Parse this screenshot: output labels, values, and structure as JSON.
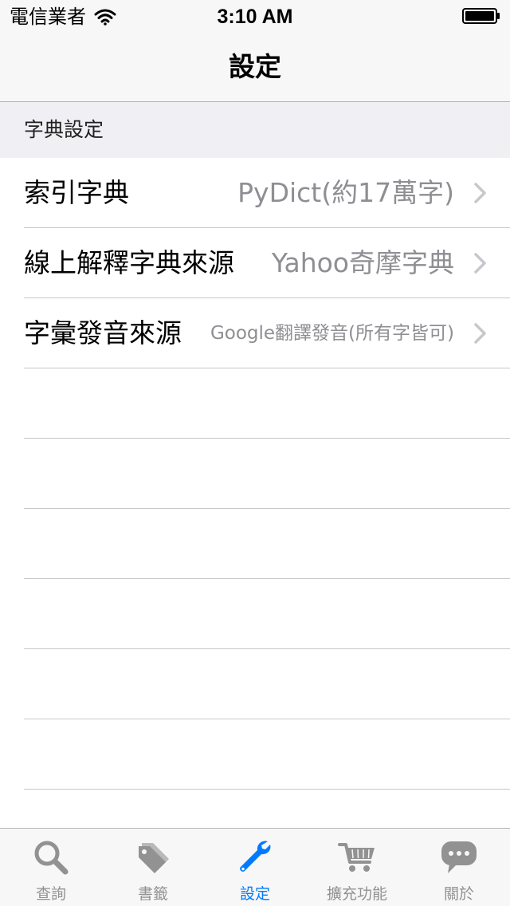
{
  "status_bar": {
    "carrier": "電信業者",
    "time": "3:10 AM"
  },
  "nav": {
    "title": "設定"
  },
  "section": {
    "header": "字典設定"
  },
  "rows": [
    {
      "label": "索引字典",
      "value": "PyDict(約17萬字)"
    },
    {
      "label": "線上解釋字典來源",
      "value": "Yahoo奇摩字典"
    },
    {
      "label": "字彙發音來源",
      "value": "Google翻譯發音(所有字皆可)"
    }
  ],
  "tabs": [
    {
      "label": "查詢",
      "icon": "search-icon",
      "active": false
    },
    {
      "label": "書籤",
      "icon": "tag-icon",
      "active": false
    },
    {
      "label": "設定",
      "icon": "wrench-icon",
      "active": true
    },
    {
      "label": "擴充功能",
      "icon": "cart-icon",
      "active": false
    },
    {
      "label": "關於",
      "icon": "chat-bubble-icon",
      "active": false
    }
  ],
  "colors": {
    "accent": "#007aff",
    "inactive": "#929292",
    "secondary_text": "#8e8e93",
    "separator": "#c8c7cc",
    "bar_background": "#f7f7f7",
    "section_background": "#efeff4"
  }
}
